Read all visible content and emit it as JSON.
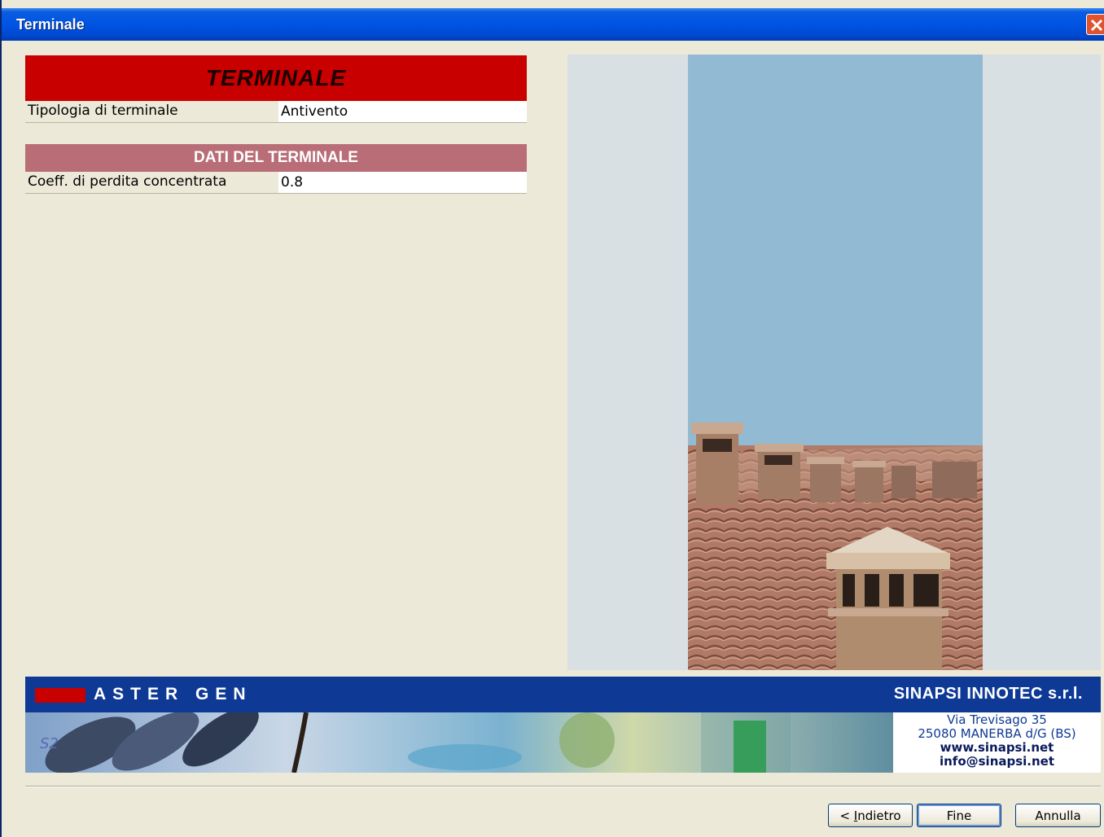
{
  "window": {
    "title": "Terminale"
  },
  "sections": {
    "terminale": {
      "header": "TERMINALE",
      "rows": [
        {
          "label": "Tipologia di terminale",
          "value": "Antivento"
        }
      ]
    },
    "dati": {
      "header": "DATI DEL TERMINALE",
      "rows": [
        {
          "label": "Coeff. di perdita concentrata",
          "value": "0.8"
        }
      ]
    }
  },
  "banner": {
    "product": "ASTER GEN",
    "company": "SINAPSI INNOTEC s.r.l.",
    "address_line1": "Via Trevisago 35",
    "address_line2": "25080 MANERBA d/G (BS)",
    "website": "www.sinapsi.net",
    "email": "info@sinapsi.net",
    "badge": "S2"
  },
  "buttons": {
    "back": "< Indietro",
    "finish": "Fine",
    "cancel": "Annulla"
  },
  "colors": {
    "header_red": "#c80000",
    "header_rose": "#b86d77",
    "banner_blue": "#0e3a96",
    "title_blue": "#0054e3"
  }
}
